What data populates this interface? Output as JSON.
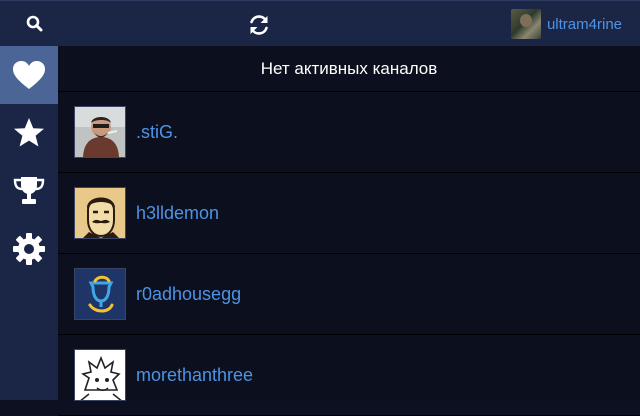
{
  "topbar": {
    "search_icon": "search-icon",
    "refresh_icon": "refresh-icon",
    "username": "ultram4rine"
  },
  "sidebar": {
    "items": [
      {
        "icon": "heart-icon",
        "active": true
      },
      {
        "icon": "star-icon",
        "active": false
      },
      {
        "icon": "trophy-icon",
        "active": false
      },
      {
        "icon": "gear-icon",
        "active": false
      }
    ]
  },
  "main": {
    "header": "Нет активных каналов",
    "channels": [
      {
        "name": ".stiG."
      },
      {
        "name": "h3lldemon"
      },
      {
        "name": "r0adhousegg"
      },
      {
        "name": "morethanthree"
      }
    ]
  },
  "colors": {
    "topbar_bg": "#1b2647",
    "sidebar_active": "#4b6596",
    "link_blue": "#4d93e6",
    "main_bg": "#0c0f1d"
  }
}
